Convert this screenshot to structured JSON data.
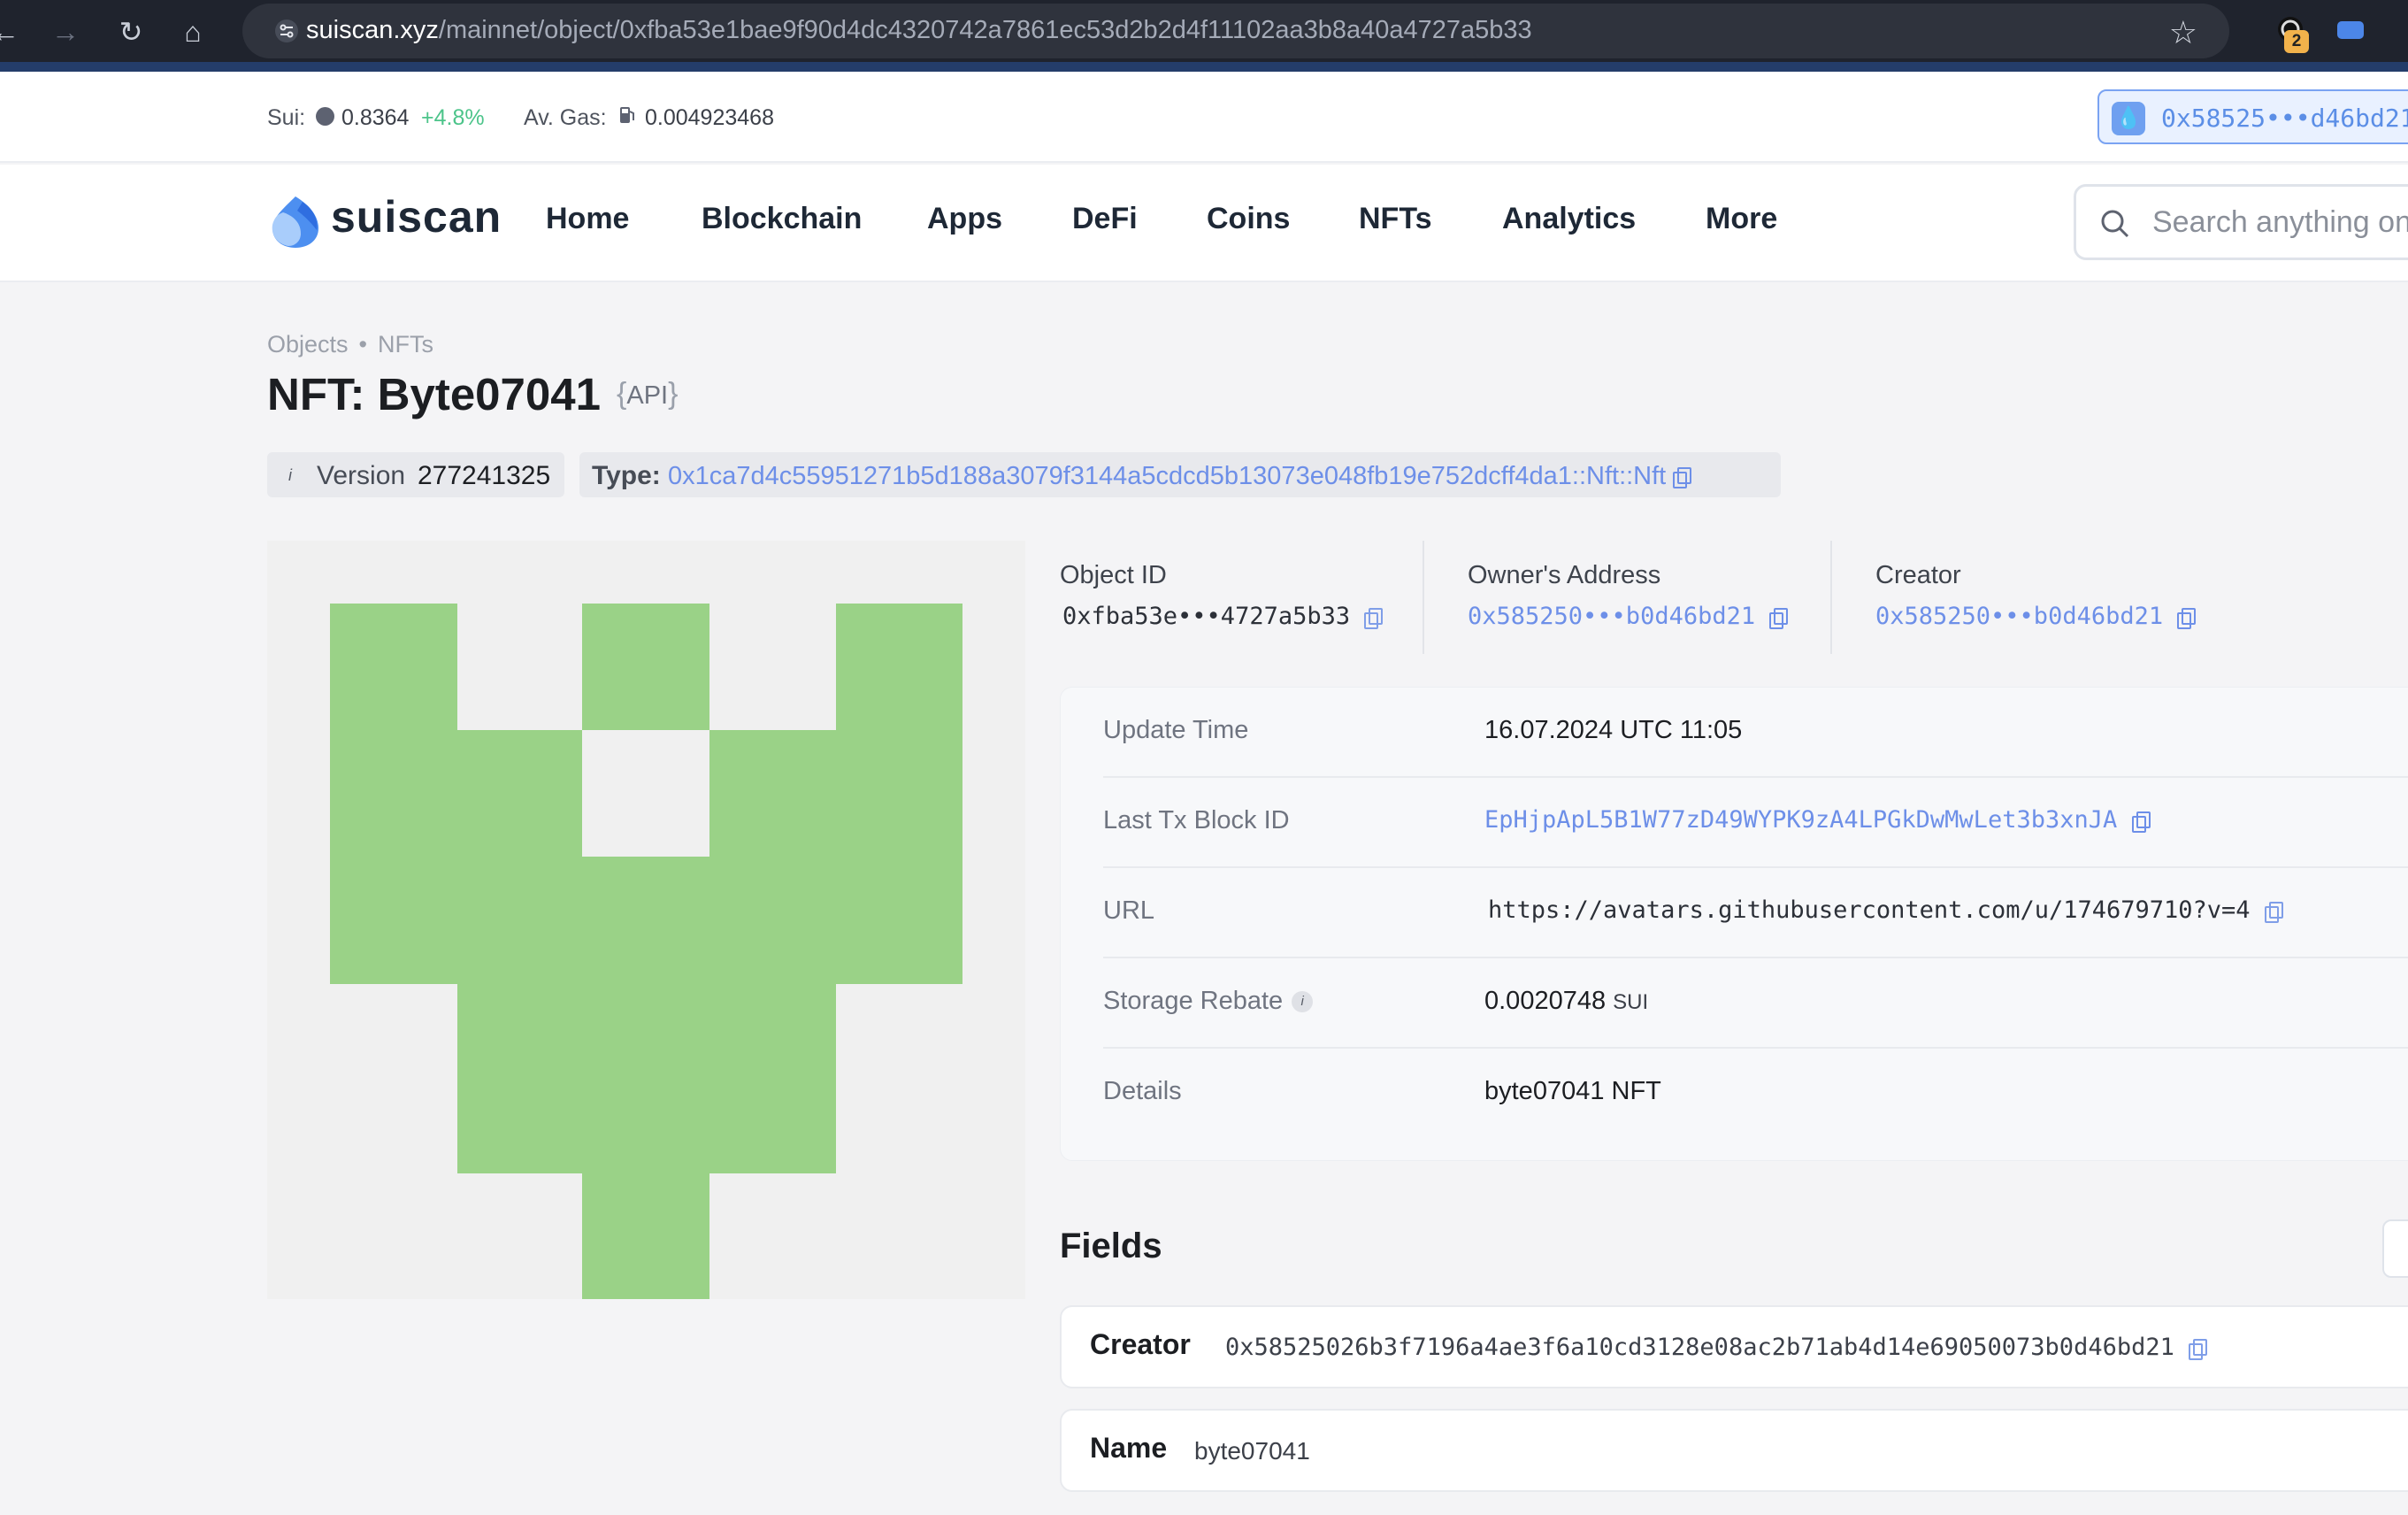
{
  "browser": {
    "url_host": "suiscan.xyz",
    "url_path": "/mainnet/object/0xfba53e1bae9f90d4dc4320742a7861ec53d2b2d4f11102aa3b8a40a4727a5b33",
    "extension_badge": "2"
  },
  "topbar": {
    "sui_label": "Sui:",
    "sui_price": "0.8364",
    "sui_change": "+4.8%",
    "gas_label": "Av. Gas:",
    "gas_value": "0.004923468",
    "wallet_address": "0x58525•••d46bd21"
  },
  "navbar": {
    "logo_text": "suiscan",
    "items": [
      "Home",
      "Blockchain",
      "Apps",
      "DeFi",
      "Coins",
      "NFTs",
      "Analytics",
      "More"
    ],
    "search_placeholder": "Search anything on Sui"
  },
  "breadcrumb": [
    "Objects",
    "NFTs"
  ],
  "title": "NFT: Byte07041",
  "api_label": "API",
  "version": {
    "label": "Version",
    "value": "277241325"
  },
  "type": {
    "label": "Type:",
    "value": "0x1ca7d4c55951271b5d188a3079f3144a5cdcd5b13073e048fb19e752dcff4da1::Nft::Nft"
  },
  "ids": {
    "object_id_label": "Object ID",
    "object_id": "0xfba53e•••4727a5b33",
    "owner_label": "Owner's Address",
    "owner": "0x585250•••b0d46bd21",
    "creator_label": "Creator",
    "creator": "0x585250•••b0d46bd21"
  },
  "details": {
    "update_time_label": "Update Time",
    "update_time": "16.07.2024 UTC 11:05",
    "last_tx_label": "Last Tx Block ID",
    "last_tx": "EpHjpApL5B1W77zD49WYPK9zA4LPGkDwMwLet3b3xnJA",
    "url_label": "URL",
    "url": "https://avatars.githubusercontent.com/u/174679710?v=4",
    "storage_rebate_label": "Storage Rebate",
    "storage_rebate": "0.0020748",
    "storage_rebate_unit": "SUI",
    "details_label": "Details",
    "details": "byte07041 NFT"
  },
  "fields": {
    "heading": "Fields",
    "items": [
      {
        "key": "Creator",
        "value": "0x58525026b3f7196a4ae3f6a10cd3128e08ac2b71ab4d14e69050073b0d46bd21"
      },
      {
        "key": "Name",
        "value": "byte07041"
      }
    ]
  },
  "colors": {
    "accent_link": "#6d8fe8",
    "nft_green": "#9ad287",
    "nft_background": "#f0f0f0",
    "positive_change": "#4cc48a"
  }
}
